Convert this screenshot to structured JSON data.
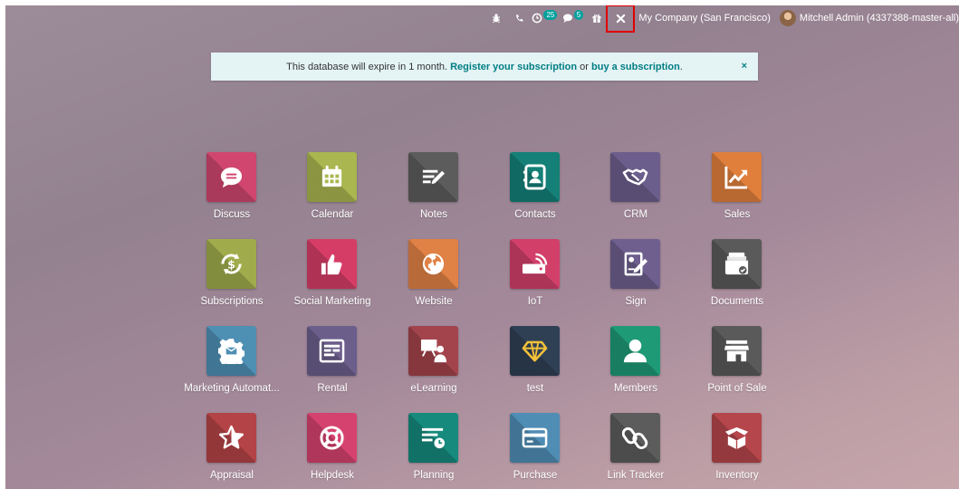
{
  "topbar": {
    "chat_badge": "25",
    "activity_badge": "5",
    "company": "My Company (San Francisco)",
    "user": "Mitchell Admin (4337388-master-all)"
  },
  "banner": {
    "text_before": "This database will expire in 1 month. ",
    "link_register": "Register your subscription",
    "text_middle": " or ",
    "link_buy": "buy a subscription",
    "text_after": ".",
    "close": "×"
  },
  "apps": [
    {
      "label": "Discuss",
      "color": "#d0466f",
      "icon": "discuss-icon"
    },
    {
      "label": "Calendar",
      "color": "#aab64f",
      "icon": "calendar-icon"
    },
    {
      "label": "Notes",
      "color": "#5c5c5c",
      "icon": "notes-icon"
    },
    {
      "label": "Contacts",
      "color": "#148077",
      "icon": "contacts-icon"
    },
    {
      "label": "CRM",
      "color": "#6c5e8c",
      "icon": "handshake-icon"
    },
    {
      "label": "Sales",
      "color": "#e07f3c",
      "icon": "trend-chart-icon"
    },
    {
      "label": "Subscriptions",
      "color": "#a0ac4c",
      "icon": "subscription-cycle-icon"
    },
    {
      "label": "Social Marketing",
      "color": "#d63d66",
      "icon": "thumbs-up-icon"
    },
    {
      "label": "Website",
      "color": "#e08145",
      "icon": "globe-icon"
    },
    {
      "label": "IoT",
      "color": "#d2406a",
      "icon": "iot-device-icon"
    },
    {
      "label": "Sign",
      "color": "#6e5f8e",
      "icon": "sign-document-icon"
    },
    {
      "label": "Documents",
      "color": "#5a5a5a",
      "icon": "documents-folder-icon"
    },
    {
      "label": "Marketing Automat...",
      "color": "#4e8fb4",
      "icon": "gear-mail-icon"
    },
    {
      "label": "Rental",
      "color": "#6b5e8b",
      "icon": "rental-calendar-icon"
    },
    {
      "label": "eLearning",
      "color": "#a3434c",
      "icon": "presentation-icon"
    },
    {
      "label": "test",
      "color": "#2f4055",
      "icon": "diamond-icon"
    },
    {
      "label": "Members",
      "color": "#1e9a76",
      "icon": "member-person-icon"
    },
    {
      "label": "Point of Sale",
      "color": "#5a5a5a",
      "icon": "shop-icon"
    },
    {
      "label": "Appraisal",
      "color": "#b34346",
      "icon": "star-icon"
    },
    {
      "label": "Helpdesk",
      "color": "#d6426f",
      "icon": "lifebuoy-icon"
    },
    {
      "label": "Planning",
      "color": "#168a7d",
      "icon": "planning-icon"
    },
    {
      "label": "Purchase",
      "color": "#4f8db5",
      "icon": "credit-card-icon"
    },
    {
      "label": "Link Tracker",
      "color": "#5c5c5c",
      "icon": "link-icon"
    },
    {
      "label": "Inventory",
      "color": "#b5464b",
      "icon": "box-icon"
    }
  ]
}
